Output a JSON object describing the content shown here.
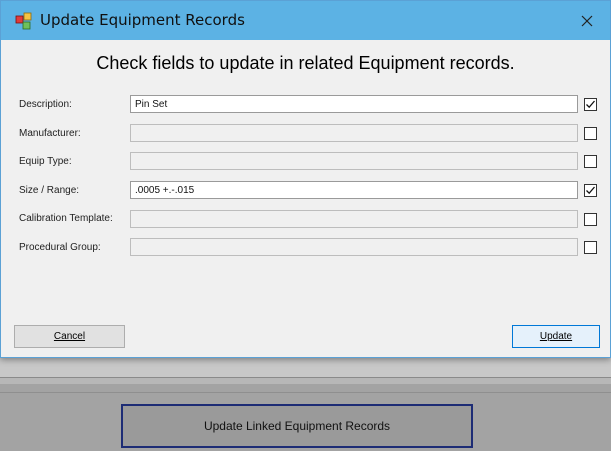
{
  "dialog": {
    "title": "Update Equipment Records",
    "heading": "Check fields to update in related Equipment records.",
    "fields": [
      {
        "label": "Description:",
        "value": "Pin Set",
        "checked": true
      },
      {
        "label": "Manufacturer:",
        "value": "",
        "checked": false
      },
      {
        "label": "Equip Type:",
        "value": "",
        "checked": false
      },
      {
        "label": "Size / Range:",
        "value": ".0005 +.-.015",
        "checked": true
      },
      {
        "label": "Calibration Template:",
        "value": "",
        "checked": false
      },
      {
        "label": "Procedural Group:",
        "value": "",
        "checked": false
      }
    ],
    "cancel_label": "Cancel",
    "update_label": "Update"
  },
  "background": {
    "linked_button_label": "Update Linked Equipment Records"
  }
}
